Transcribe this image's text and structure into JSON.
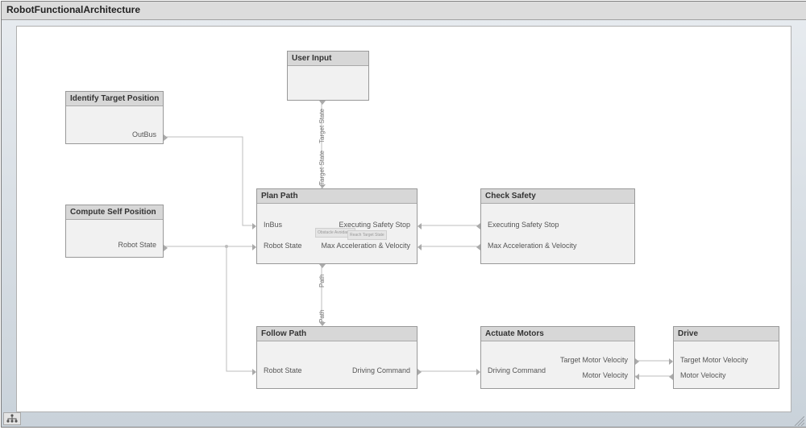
{
  "frame": {
    "title": "RobotFunctionalArchitecture"
  },
  "blocks": {
    "identify": {
      "title": "Identify Target Position",
      "ports": {
        "out_bus": "OutBus"
      }
    },
    "compute": {
      "title": "Compute Self Position",
      "ports": {
        "robot_state": "Robot State"
      }
    },
    "user_input": {
      "title": "User Input",
      "ports": {
        "target_state": "Target State"
      }
    },
    "plan": {
      "title": "Plan Path",
      "ports": {
        "in_bus": "InBus",
        "robot_state": "Robot State",
        "target_state": "Target State",
        "exec_stop": "Executing Safety Stop",
        "max_av": "Max Acceleration & Velocity",
        "path": "Path"
      },
      "internal": {
        "chip1": "Obstacle Avoidance",
        "chip2": "Reach Target State"
      }
    },
    "check": {
      "title": "Check Safety",
      "ports": {
        "exec_stop": "Executing Safety Stop",
        "max_av": "Max Acceleration & Velocity"
      }
    },
    "follow": {
      "title": "Follow Path",
      "ports": {
        "robot_state": "Robot State",
        "path": "Path",
        "drive_cmd": "Driving Command"
      }
    },
    "actuate": {
      "title": "Actuate Motors",
      "ports": {
        "drive_cmd": "Driving Command",
        "t_motor_v": "Target Motor Velocity",
        "motor_v": "Motor Velocity"
      }
    },
    "drive": {
      "title": "Drive",
      "ports": {
        "t_motor_v": "Target Motor Velocity",
        "motor_v": "Motor Velocity"
      }
    }
  },
  "wires": {
    "target_state": "Target State",
    "path": "Path"
  }
}
